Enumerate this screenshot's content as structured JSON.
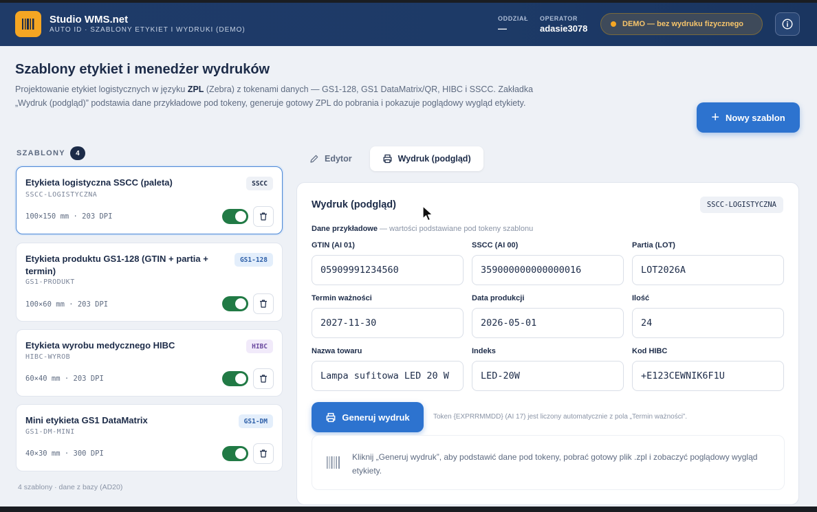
{
  "header": {
    "app_title": "Studio WMS.net",
    "app_subtitle": "AUTO ID · SZABLONY ETYKIET I WYDRUKI (DEMO)",
    "branch_label": "ODDZIAŁ",
    "branch_value": "—",
    "operator_label": "OPERATOR",
    "operator_value": "adasie3078",
    "demo_badge": "DEMO — bez wydruku fizycznego",
    "colors": {
      "header_bg": "#1f3b68",
      "logo_bg": "#f5a623",
      "demo_text": "#f7c56b"
    }
  },
  "page": {
    "title": "Szablony etykiet i menedżer wydruków",
    "desc_part1": "Projektowanie etykiet logistycznych w języku ",
    "desc_bold": "ZPL",
    "desc_part2": " (Zebra) z tokenami danych — GS1-128, GS1 DataMatrix/QR, HIBC i SSCC. Zakładka „Wydruk (podgląd)” podstawia dane przykładowe pod tokeny, generuje gotowy ZPL do pobrania i pokazuje poglądowy wygląd etykiety.",
    "new_template_button": "Nowy szablon",
    "accent_color": "#2d73cf"
  },
  "templates": {
    "label": "SZABLONY",
    "count": "4",
    "footer": "4 szablony · dane z bazy (AD20)",
    "items": [
      {
        "title": "Etykieta logistyczna SSCC (paleta)",
        "code": "SSCC-LOGISTYCZNA",
        "meta": "100×150 mm · 203 DPI",
        "tag": "SSCC",
        "tag_bg": "#eef1f6",
        "tag_fg": "#1c2b48",
        "enabled": true
      },
      {
        "title": "Etykieta produktu GS1-128 (GTIN + partia + termin)",
        "code": "GS1-PRODUKT",
        "meta": "100×60 mm · 203 DPI",
        "tag": "GS1-128",
        "tag_bg": "#e3eefb",
        "tag_fg": "#2d5fa8",
        "enabled": true
      },
      {
        "title": "Etykieta wyrobu medycznego HIBC",
        "code": "HIBC-WYROB",
        "meta": "60×40 mm · 203 DPI",
        "tag": "HIBC",
        "tag_bg": "#f1eafa",
        "tag_fg": "#6b4aa0",
        "enabled": true
      },
      {
        "title": "Mini etykieta GS1 DataMatrix",
        "code": "GS1-DM-MINI",
        "meta": "40×30 mm · 300 DPI",
        "tag": "GS1-DM",
        "tag_bg": "#e3eefb",
        "tag_fg": "#2d5fa8",
        "enabled": true
      }
    ]
  },
  "tabs": {
    "editor": "Edytor",
    "print_preview": "Wydruk (podgląd)",
    "active": "print_preview"
  },
  "preview": {
    "title": "Wydruk (podgląd)",
    "template_code": "SSCC-LOGISTYCZNA",
    "sample_bold": "Dane przykładowe",
    "sample_rest": " — wartości podstawiane pod tokeny szablonu",
    "fields": [
      {
        "label": "GTIN (AI 01)",
        "value": "05909991234560"
      },
      {
        "label": "SSCC (AI 00)",
        "value": "359000000000000016"
      },
      {
        "label": "Partia (LOT)",
        "value": "LOT2026A"
      },
      {
        "label": "Termin ważności",
        "value": "2027-11-30"
      },
      {
        "label": "Data produkcji",
        "value": "2026-05-01"
      },
      {
        "label": "Ilość",
        "value": "24"
      },
      {
        "label": "Nazwa towaru",
        "value": "Lampa sufitowa LED 20 W"
      },
      {
        "label": "Indeks",
        "value": "LED-20W"
      },
      {
        "label": "Kod HIBC",
        "value": "+E123CEWNIK6F1U"
      }
    ],
    "generate_button": "Generuj wydruk",
    "token_note": "Token {EXPRRMMDD} (AI 17) jest liczony automatycznie z pola „Termin ważności”.",
    "hint": "Kliknij „Generuj wydruk”, aby podstawić dane pod tokeny, pobrać gotowy plik .zpl i zobaczyć poglądowy wygląd etykiety."
  }
}
